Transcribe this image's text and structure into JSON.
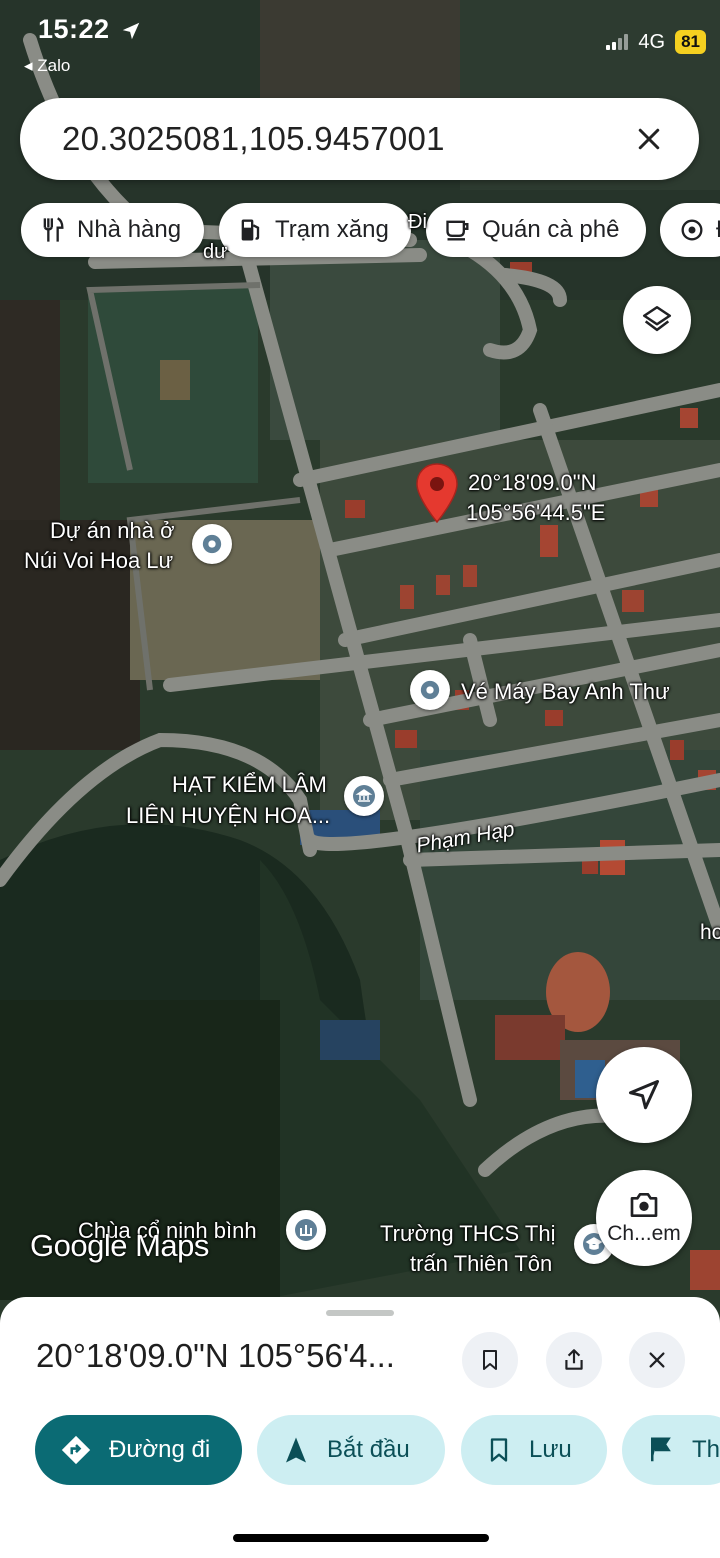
{
  "status_bar": {
    "time": "15:22",
    "back_app": "◂ Zalo",
    "network": "4G",
    "battery": "81"
  },
  "search": {
    "value": "20.3025081,105.9457001"
  },
  "chips": [
    {
      "label": "Nhà hàng",
      "icon": "restaurant-icon"
    },
    {
      "label": "Trạm xăng",
      "icon": "gas-station-icon"
    },
    {
      "label": "Quán cà phê",
      "icon": "coffee-icon"
    },
    {
      "label": "Đ",
      "icon": "attractions-icon"
    }
  ],
  "map": {
    "pin_label_line1": "20°18'09.0\"N",
    "pin_label_line2": "105°56'44.5\"E",
    "places": {
      "housing_project_line1": "Dự án nhà ở",
      "housing_project_line2": "Núi Voi Hoa Lư",
      "ticket_agency": "Vé Máy Bay Anh Thư",
      "forest_office_line1": "HẠT KIỂM LÂM",
      "forest_office_line2": "LIÊN HUYỆN HOA...",
      "street": "Phạm Hạp",
      "temple": "Chùa cổ ninh bình",
      "school_line1": "Trường THCS Thị",
      "school_line2": "trấn Thiên Tôn",
      "top_partial": "Đi",
      "top_partial_2": "dư",
      "right_partial": "ho"
    },
    "watermark": "Google Maps",
    "camera_button_label": "Ch...em"
  },
  "sheet": {
    "title": "20°18'09.0\"N 105°56'4...",
    "actions": [
      {
        "label": "Đường đi",
        "icon": "directions-icon"
      },
      {
        "label": "Bắt đầu",
        "icon": "navigation-icon"
      },
      {
        "label": "Lưu",
        "icon": "bookmark-icon"
      },
      {
        "label": "Th",
        "icon": "flag-icon"
      }
    ]
  },
  "colors": {
    "primary": "#0b6b74",
    "secondary": "#cdeef2",
    "pin": "#e5392f"
  }
}
